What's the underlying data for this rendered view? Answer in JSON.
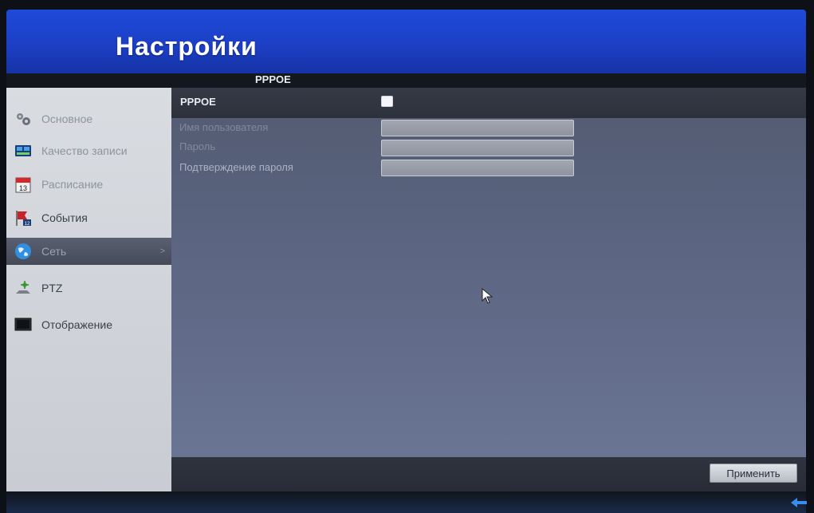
{
  "header": {
    "title": "Настройки"
  },
  "section": {
    "title": "PPPOE"
  },
  "sidebar": {
    "items": [
      {
        "label": "Основное",
        "icon": "gear-icon"
      },
      {
        "label": "Качество записи",
        "icon": "record-quality-icon"
      },
      {
        "label": "Расписание",
        "icon": "calendar-icon",
        "badge": "13"
      },
      {
        "label": "События",
        "icon": "events-flag-icon",
        "badge": "12"
      },
      {
        "label": "Сеть",
        "icon": "network-globe-icon",
        "active": true,
        "arrow": ">"
      },
      {
        "label": "PTZ",
        "icon": "ptz-camera-icon"
      },
      {
        "label": "Отображение",
        "icon": "display-monitor-icon"
      }
    ]
  },
  "form": {
    "pppoe_label": "PPPOE",
    "pppoe_enabled": false,
    "fields": [
      {
        "label": "Имя пользователя",
        "value": ""
      },
      {
        "label": "Пароль",
        "value": ""
      },
      {
        "label": "Подтверждение пароля",
        "value": ""
      }
    ]
  },
  "actions": {
    "apply_label": "Применить"
  },
  "colors": {
    "header_blue": "#1e4ad8",
    "panel_slate": "#5b6480",
    "sidebar_gray": "#d0d3d9",
    "active_item": "#4c5262"
  }
}
